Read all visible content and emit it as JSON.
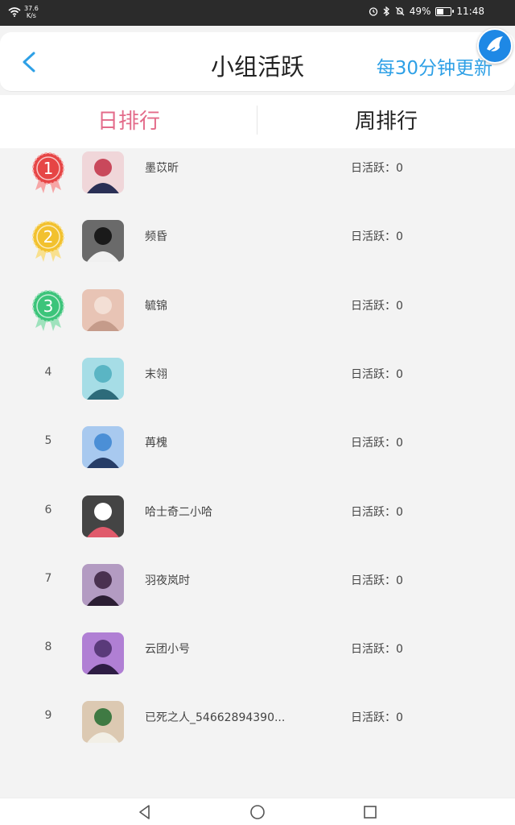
{
  "status_bar": {
    "net_speed_value": "37.6",
    "net_speed_unit": "K/s",
    "battery_percent": "49%",
    "battery_level": 0.49,
    "time": "11:48"
  },
  "header": {
    "title": "小组活跃",
    "update_note": "每30分钟更新"
  },
  "tabs": [
    {
      "label": "日排行",
      "active": true
    },
    {
      "label": "周排行",
      "active": false
    }
  ],
  "colors": {
    "accent_pink": "#e36b8a",
    "accent_blue": "#2ea0e6",
    "medal_gold_red": "#e64545",
    "medal_yellow": "#f2c12e",
    "medal_green": "#3cc47a"
  },
  "ranking": [
    {
      "rank": "1",
      "name": "墨苡昕",
      "activity": "日活跃：0",
      "medal": "red"
    },
    {
      "rank": "2",
      "name": "频昏",
      "activity": "日活跃：0",
      "medal": "yellow"
    },
    {
      "rank": "3",
      "name": "毓锦",
      "activity": "日活跃：0",
      "medal": "green"
    },
    {
      "rank": "4",
      "name": "末翎",
      "activity": "日活跃：0"
    },
    {
      "rank": "5",
      "name": "苒槐",
      "activity": "日活跃：0"
    },
    {
      "rank": "6",
      "name": "哈士奇二小哈",
      "activity": "日活跃：0"
    },
    {
      "rank": "7",
      "name": "羽夜岚时",
      "activity": "日活跃：0"
    },
    {
      "rank": "8",
      "name": "云团小号",
      "activity": "日活跃：0"
    },
    {
      "rank": "9",
      "name": "已死之人_54662894390...",
      "activity": "日活跃：0"
    }
  ],
  "nav": {
    "back_icon": "triangle-back-icon",
    "home_icon": "circle-home-icon",
    "recent_icon": "square-recent-icon"
  }
}
